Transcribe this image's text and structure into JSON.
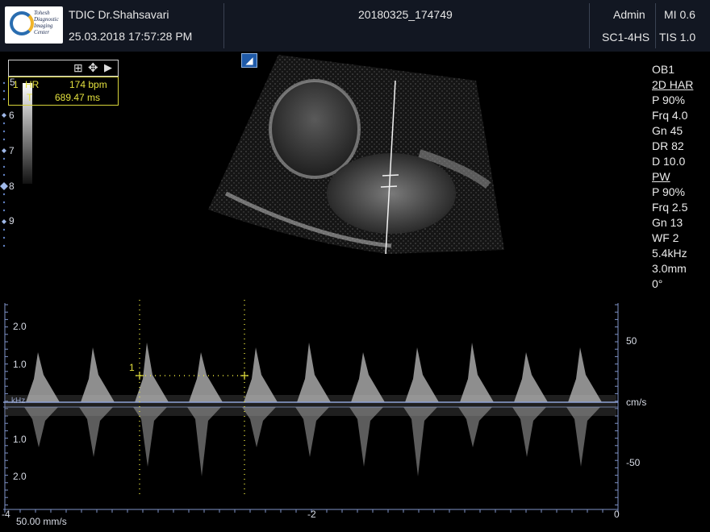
{
  "header": {
    "logo_text": "Tohesh Diagnostic Imaging Center",
    "institution": "TDIC Dr.Shahsavari",
    "datetime": "25.03.2018   17:57:28 PM",
    "study_id": "20180325_174749",
    "user": "Admin",
    "probe": "SC1-4HS",
    "mi": "MI 0.6",
    "tis": "TIS 1.0"
  },
  "measure": {
    "index": "1",
    "hr_label": "HR",
    "hr_value": "174 bpm",
    "t_label": "T",
    "t_value": "689.47 ms"
  },
  "depth_scale": [
    "5",
    "6",
    "7",
    "8",
    "9"
  ],
  "right_panel": {
    "preset": "OB1",
    "mode_2d": "2D HAR",
    "p2d": "P 90%",
    "frq2d": "Frq 4.0",
    "gn2d": "Gn 45",
    "dr": "DR 82",
    "d": "D 10.0",
    "mode_pw": "PW",
    "ppw": "P 90%",
    "frqpw": "Frq 2.5",
    "gnpw": "Gn 13",
    "wf": "WF 2",
    "prf": "5.4kHz",
    "gate": "3.0mm",
    "angle": "0°"
  },
  "doppler": {
    "left_scale": [
      "2.0",
      "1.0",
      "kHz",
      "1.0",
      "2.0"
    ],
    "right_scale": [
      "50",
      "cm/s",
      "-50"
    ],
    "time_axis": [
      "-4",
      "-2",
      "0"
    ],
    "sweep_speed": "50.00 mm/s",
    "caliper_label": "1"
  },
  "colors": {
    "header_bg": "#121722",
    "measure_yellow": "#e4e13e",
    "baseline": "#7f93c9"
  },
  "icons": {
    "freeze_icon": "A-glyph",
    "toolbar": [
      "grid-icon",
      "move-icon",
      "play-icon"
    ]
  }
}
